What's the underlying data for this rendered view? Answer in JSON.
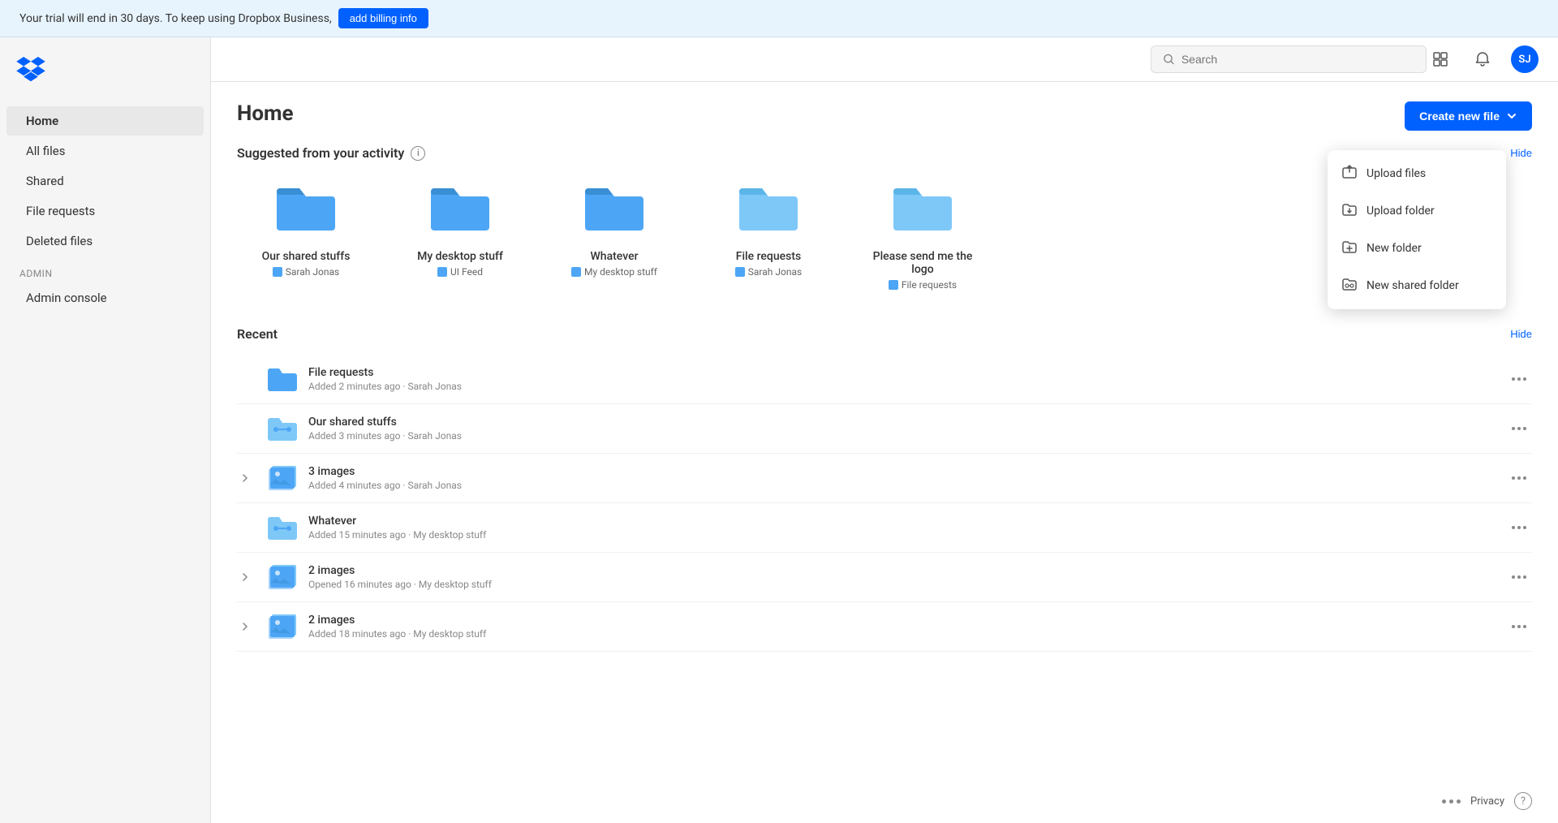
{
  "trial": {
    "message": "Your trial will end in 30 days. To keep using Dropbox Business,",
    "cta": "add billing info"
  },
  "sidebar": {
    "items": [
      {
        "id": "home",
        "label": "Home",
        "active": true
      },
      {
        "id": "all-files",
        "label": "All files",
        "active": false
      },
      {
        "id": "shared",
        "label": "Shared",
        "active": false
      },
      {
        "id": "file-requests",
        "label": "File requests",
        "active": false
      },
      {
        "id": "deleted-files",
        "label": "Deleted files",
        "active": false
      }
    ],
    "admin_section": "Admin",
    "admin_items": [
      {
        "id": "admin-console",
        "label": "Admin console"
      }
    ]
  },
  "topbar": {
    "search_placeholder": "Search",
    "avatar_initials": "SJ"
  },
  "page": {
    "title": "Home"
  },
  "suggested": {
    "section_title": "Suggested from your activity",
    "hide_label": "Hide",
    "folders": [
      {
        "name": "Our shared stuffs",
        "meta": "Sarah Jonas",
        "color": "blue"
      },
      {
        "name": "My desktop stuff",
        "meta": "UI Feed",
        "color": "blue"
      },
      {
        "name": "Whatever",
        "meta": "My desktop stuff",
        "color": "blue"
      },
      {
        "name": "File requests",
        "meta": "Sarah Jonas",
        "color": "light"
      },
      {
        "name": "Please send me the logo",
        "meta": "File requests",
        "color": "light"
      }
    ]
  },
  "recent": {
    "section_title": "Recent",
    "hide_label": "Hide",
    "items": [
      {
        "name": "File requests",
        "sub": "Added 2 minutes ago · Sarah Jonas",
        "type": "folder",
        "has_expand": false
      },
      {
        "name": "Our shared stuffs",
        "sub": "Added 3 minutes ago · Sarah Jonas",
        "type": "shared-folder",
        "has_expand": false
      },
      {
        "name": "3 images",
        "sub": "Added 4 minutes ago · Sarah Jonas",
        "type": "image-group",
        "has_expand": true
      },
      {
        "name": "Whatever",
        "sub": "Added 15 minutes ago · My desktop stuff",
        "type": "shared-folder",
        "has_expand": false
      },
      {
        "name": "2 images",
        "sub": "Opened 16 minutes ago · My desktop stuff",
        "type": "image-group",
        "has_expand": true
      },
      {
        "name": "2 images",
        "sub": "Added 18 minutes ago · My desktop stuff",
        "type": "image-group",
        "has_expand": true
      }
    ]
  },
  "create_menu": {
    "button_label": "Create new file",
    "items": [
      {
        "id": "upload-files",
        "label": "Upload files"
      },
      {
        "id": "upload-folder",
        "label": "Upload folder"
      },
      {
        "id": "new-folder",
        "label": "New folder"
      },
      {
        "id": "new-shared-folder",
        "label": "New shared folder"
      }
    ]
  },
  "footer": {
    "privacy": "Privacy"
  },
  "colors": {
    "accent": "#0061ff",
    "folder_blue": "#4da6f5",
    "folder_light": "#7ec8f8"
  }
}
